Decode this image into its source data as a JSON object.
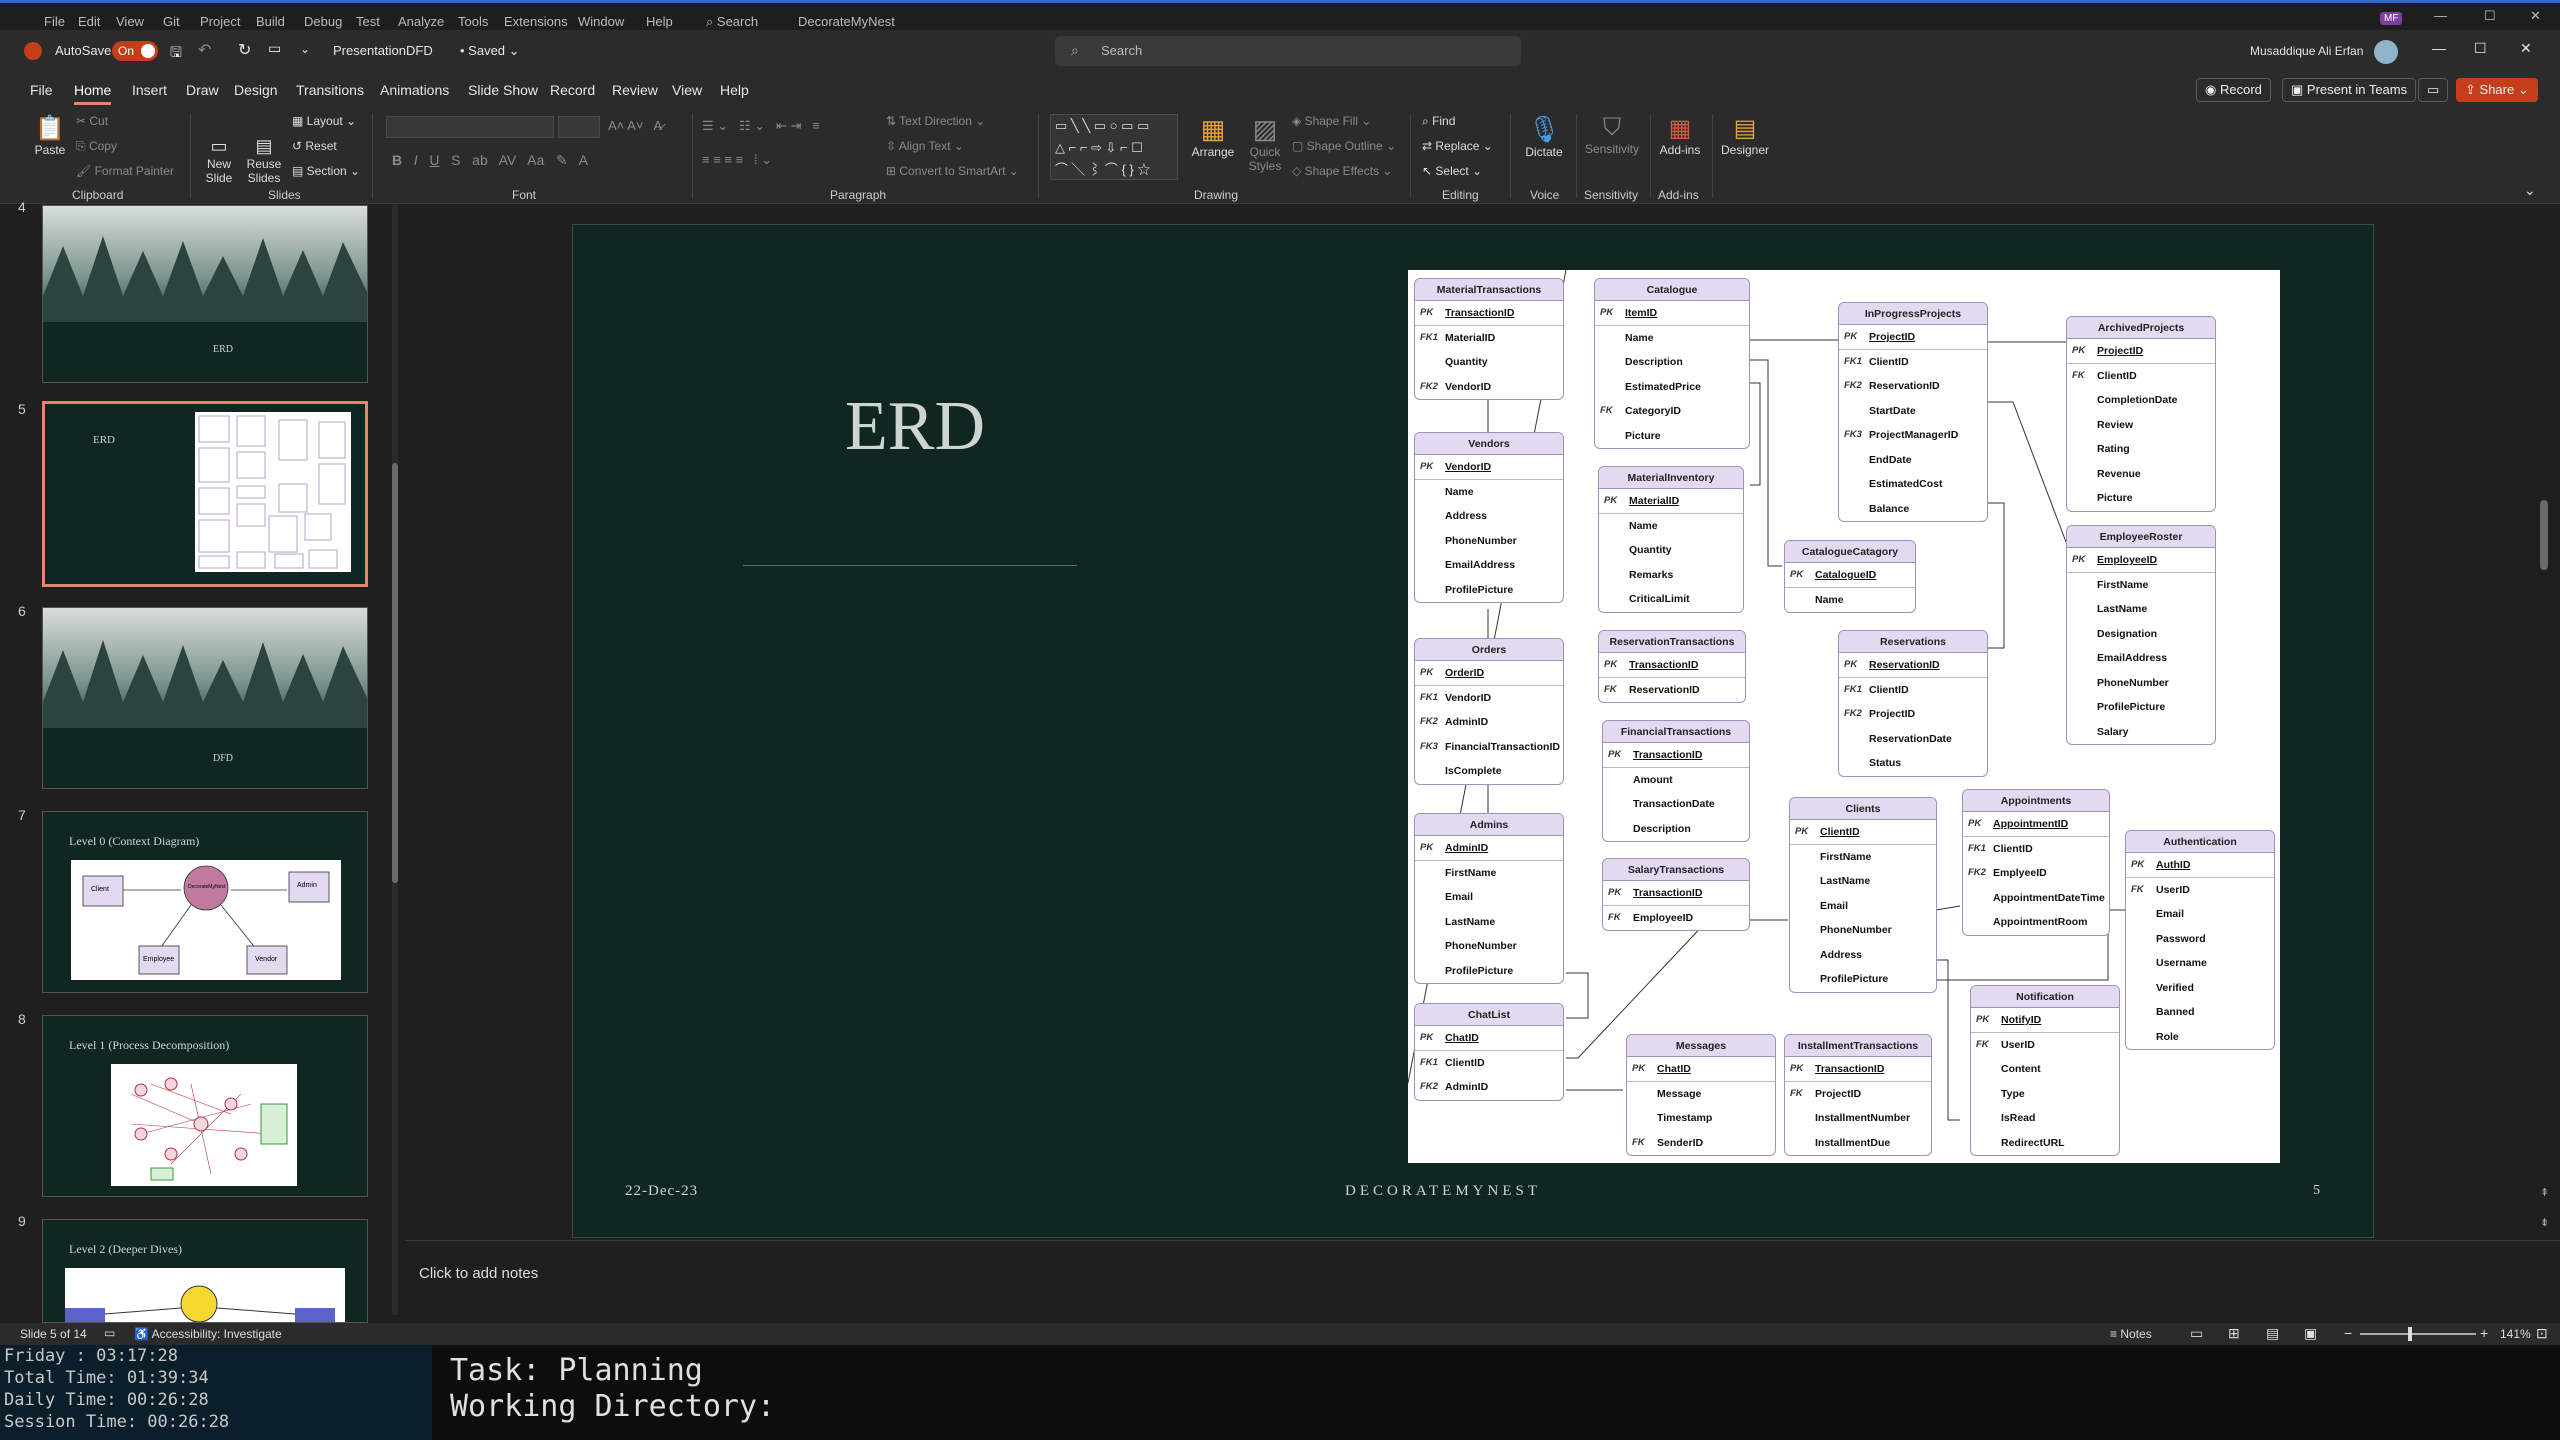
{
  "vs_menu": [
    "File",
    "Edit",
    "View",
    "Git",
    "Project",
    "Build",
    "Debug",
    "Test",
    "Analyze",
    "Tools",
    "Extensions",
    "Window",
    "Help"
  ],
  "vs_search": "Search",
  "vs_solution": "DecorateMyNest",
  "vs_avatar": "MF",
  "titlebar": {
    "autosave_label": "AutoSave",
    "autosave_state": "On",
    "doc_title": "PresentationDFD",
    "saved": "Saved",
    "search_placeholder": "Search",
    "user_name": "Musaddique Ali Erfan"
  },
  "ribbon_tabs": [
    "File",
    "Home",
    "Insert",
    "Draw",
    "Design",
    "Transitions",
    "Animations",
    "Slide Show",
    "Record",
    "Review",
    "View",
    "Help"
  ],
  "ribbon_actions": {
    "record": "Record",
    "present": "Present in Teams",
    "share": "Share"
  },
  "ribbon": {
    "clipboard": {
      "paste": "Paste",
      "cut": "Cut",
      "copy": "Copy",
      "format_painter": "Format Painter",
      "label": "Clipboard"
    },
    "slides": {
      "new_slide": "New Slide",
      "reuse": "Reuse Slides",
      "layout": "Layout",
      "reset": "Reset",
      "section": "Section",
      "label": "Slides"
    },
    "font": {
      "label": "Font"
    },
    "paragraph": {
      "text_direction": "Text Direction",
      "align_text": "Align Text",
      "smartart": "Convert to SmartArt",
      "label": "Paragraph"
    },
    "drawing": {
      "arrange": "Arrange",
      "quick_styles": "Quick Styles",
      "shape_fill": "Shape Fill",
      "shape_outline": "Shape Outline",
      "shape_effects": "Shape Effects",
      "label": "Drawing"
    },
    "editing": {
      "find": "Find",
      "replace": "Replace",
      "select": "Select",
      "label": "Editing"
    },
    "voice": {
      "dictate": "Dictate",
      "label": "Voice"
    },
    "sensitivity": {
      "sensitivity": "Sensitivity",
      "label": "Sensitivity"
    },
    "addins": {
      "addins": "Add-ins",
      "label": "Add-ins"
    },
    "designer": {
      "designer": "Designer"
    }
  },
  "thumbnails": [
    {
      "num": "4",
      "title": "ERD"
    },
    {
      "num": "5",
      "title": "ERD"
    },
    {
      "num": "6",
      "title": "DFD"
    },
    {
      "num": "7",
      "title": "Level 0 (Context Diagram)"
    },
    {
      "num": "8",
      "title": "Level 1 (Process Decomposition)"
    },
    {
      "num": "9",
      "title": "Level 2 (Deeper Dives)"
    }
  ],
  "thumb7_nodes": {
    "client": "Client",
    "center": "DecorateMyNest",
    "admin": "Admin",
    "employee": "Employee",
    "vendor": "Vendor"
  },
  "slide": {
    "title": "ERD",
    "date": "22-Dec-23",
    "footer": "DECORATEMYNEST",
    "page": "5"
  },
  "entities": {
    "material_transactions": {
      "name": "MaterialTransactions",
      "rows": [
        [
          "PK",
          "TransactionID"
        ],
        [
          "FK1",
          "MaterialID"
        ],
        [
          "",
          "Quantity"
        ],
        [
          "FK2",
          "VendorID"
        ]
      ]
    },
    "catalogue": {
      "name": "Catalogue",
      "rows": [
        [
          "PK",
          "ItemID"
        ],
        [
          "",
          "Name"
        ],
        [
          "",
          "Description"
        ],
        [
          "",
          "EstimatedPrice"
        ],
        [
          "FK",
          "CategoryID"
        ],
        [
          "",
          "Picture"
        ]
      ]
    },
    "inprogress_projects": {
      "name": "InProgressProjects",
      "rows": [
        [
          "PK",
          "ProjectID"
        ],
        [
          "FK1",
          "ClientID"
        ],
        [
          "FK2",
          "ReservationID"
        ],
        [
          "",
          "StartDate"
        ],
        [
          "FK3",
          "ProjectManagerID"
        ],
        [
          "",
          "EndDate"
        ],
        [
          "",
          "EstimatedCost"
        ],
        [
          "",
          "Balance"
        ]
      ]
    },
    "archived_projects": {
      "name": "ArchivedProjects",
      "rows": [
        [
          "PK",
          "ProjectID"
        ],
        [
          "FK",
          "ClientID"
        ],
        [
          "",
          "CompletionDate"
        ],
        [
          "",
          "Review"
        ],
        [
          "",
          "Rating"
        ],
        [
          "",
          "Revenue"
        ],
        [
          "",
          "Picture"
        ]
      ]
    },
    "vendors": {
      "name": "Vendors",
      "rows": [
        [
          "PK",
          "VendorID"
        ],
        [
          "",
          "Name"
        ],
        [
          "",
          "Address"
        ],
        [
          "",
          "PhoneNumber"
        ],
        [
          "",
          "EmailAddress"
        ],
        [
          "",
          "ProfilePicture"
        ]
      ]
    },
    "material_inventory": {
      "name": "MaterialInventory",
      "rows": [
        [
          "PK",
          "MaterialID"
        ],
        [
          "",
          "Name"
        ],
        [
          "",
          "Quantity"
        ],
        [
          "",
          "Remarks"
        ],
        [
          "",
          "CriticalLimit"
        ]
      ]
    },
    "catalogue_category": {
      "name": "CatalogueCatagory",
      "rows": [
        [
          "PK",
          "CatalogueID"
        ],
        [
          "",
          "Name"
        ]
      ]
    },
    "employee_roster": {
      "name": "EmployeeRoster",
      "rows": [
        [
          "PK",
          "EmployeeID"
        ],
        [
          "",
          "FirstName"
        ],
        [
          "",
          "LastName"
        ],
        [
          "",
          "Designation"
        ],
        [
          "",
          "EmailAddress"
        ],
        [
          "",
          "PhoneNumber"
        ],
        [
          "",
          "ProfilePicture"
        ],
        [
          "",
          "Salary"
        ]
      ]
    },
    "orders": {
      "name": "Orders",
      "rows": [
        [
          "PK",
          "OrderID"
        ],
        [
          "FK1",
          "VendorID"
        ],
        [
          "FK2",
          "AdminID"
        ],
        [
          "FK3",
          "FinancialTransactionID"
        ],
        [
          "",
          "IsComplete"
        ]
      ]
    },
    "reservation_transactions": {
      "name": "ReservationTransactions",
      "rows": [
        [
          "PK",
          "TransactionID"
        ],
        [
          "FK",
          "ReservationID"
        ]
      ]
    },
    "reservations": {
      "name": "Reservations",
      "rows": [
        [
          "PK",
          "ReservationID"
        ],
        [
          "FK1",
          "ClientID"
        ],
        [
          "FK2",
          "ProjectID"
        ],
        [
          "",
          "ReservationDate"
        ],
        [
          "",
          "Status"
        ]
      ]
    },
    "financial_transactions": {
      "name": "FinancialTransactions",
      "rows": [
        [
          "PK",
          "TransactionID"
        ],
        [
          "",
          "Amount"
        ],
        [
          "",
          "TransactionDate"
        ],
        [
          "",
          "Description"
        ]
      ]
    },
    "admins": {
      "name": "Admins",
      "rows": [
        [
          "PK",
          "AdminID"
        ],
        [
          "",
          "FirstName"
        ],
        [
          "",
          "Email"
        ],
        [
          "",
          "LastName"
        ],
        [
          "",
          "PhoneNumber"
        ],
        [
          "",
          "ProfilePicture"
        ]
      ]
    },
    "salary_transactions": {
      "name": "SalaryTransactions",
      "rows": [
        [
          "PK",
          "TransactionID"
        ],
        [
          "FK",
          "EmployeeID"
        ]
      ]
    },
    "clients": {
      "name": "Clients",
      "rows": [
        [
          "PK",
          "ClientID"
        ],
        [
          "",
          "FirstName"
        ],
        [
          "",
          "LastName"
        ],
        [
          "",
          "Email"
        ],
        [
          "",
          "PhoneNumber"
        ],
        [
          "",
          "Address"
        ],
        [
          "",
          "ProfilePicture"
        ]
      ]
    },
    "appointments": {
      "name": "Appointments",
      "rows": [
        [
          "PK",
          "AppointmentID"
        ],
        [
          "FK1",
          "ClientID"
        ],
        [
          "FK2",
          "EmplyeeID"
        ],
        [
          "",
          "AppointmentDateTime"
        ],
        [
          "",
          "AppointmentRoom"
        ]
      ]
    },
    "authentication": {
      "name": "Authentication",
      "rows": [
        [
          "PK",
          "AuthID"
        ],
        [
          "FK",
          "UserID"
        ],
        [
          "",
          "Email"
        ],
        [
          "",
          "Password"
        ],
        [
          "",
          "Username"
        ],
        [
          "",
          "Verified"
        ],
        [
          "",
          "Banned"
        ],
        [
          "",
          "Role"
        ]
      ]
    },
    "chatlist": {
      "name": "ChatList",
      "rows": [
        [
          "PK",
          "ChatID"
        ],
        [
          "FK1",
          "ClientID"
        ],
        [
          "FK2",
          "AdminID"
        ]
      ]
    },
    "messages": {
      "name": "Messages",
      "rows": [
        [
          "PK",
          "ChatID"
        ],
        [
          "",
          "Message"
        ],
        [
          "",
          "Timestamp"
        ],
        [
          "FK",
          "SenderID"
        ]
      ]
    },
    "installment_transactions": {
      "name": "InstallmentTransactions",
      "rows": [
        [
          "PK",
          "TransactionID"
        ],
        [
          "FK",
          "ProjectID"
        ],
        [
          "",
          "InstallmentNumber"
        ],
        [
          "",
          "InstallmentDue"
        ]
      ]
    },
    "notification": {
      "name": "Notification",
      "rows": [
        [
          "PK",
          "NotifyID"
        ],
        [
          "FK",
          "UserID"
        ],
        [
          "",
          "Content"
        ],
        [
          "",
          "Type"
        ],
        [
          "",
          "IsRead"
        ],
        [
          "",
          "RedirectURL"
        ]
      ]
    }
  },
  "notes_placeholder": "Click to add notes",
  "status": {
    "slide": "Slide 5 of 14",
    "accessibility": "Accessibility: Investigate",
    "notes": "Notes",
    "zoom": "141%"
  },
  "terminal": {
    "line1": "Friday  :  03:17:28",
    "line2": "Total Time: 01:39:34",
    "line3": "Daily Time: 00:26:28",
    "line4": "Session Time: 00:26:28",
    "task": "Task: Planning",
    "workdir": "Working Directory:"
  },
  "colors": {
    "slide_bg": "#0f2621",
    "accent": "#c43e1c",
    "entity_header": "#e3d9f0",
    "entity_border": "#a28fbd",
    "selected_thumb": "#e8846c"
  }
}
